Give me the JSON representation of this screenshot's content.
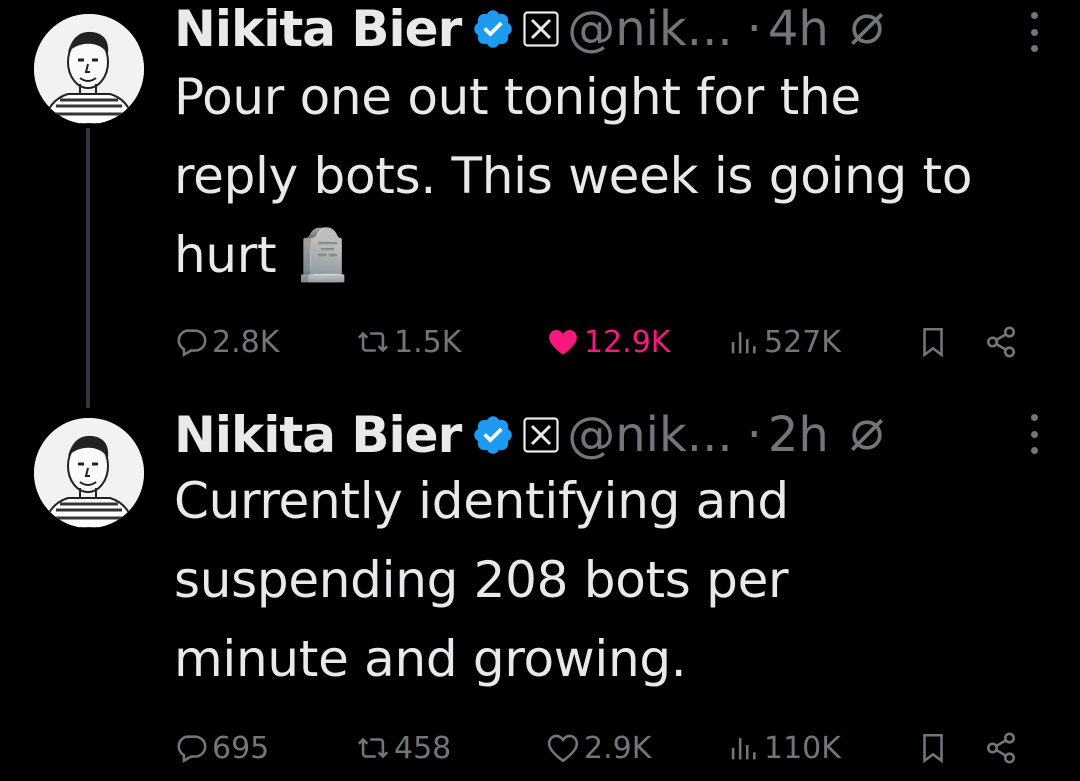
{
  "tweets": [
    {
      "author_name": "Nikita Bier",
      "handle": "@nik...",
      "separator": "·",
      "time": "4h",
      "text_lines": [
        "Pour one out tonight for the",
        "reply bots. This week is going to",
        "hurt 🪦"
      ],
      "replies": "2.8K",
      "reposts": "1.5K",
      "likes": "12.9K",
      "liked": true,
      "views": "527K"
    },
    {
      "author_name": "Nikita Bier",
      "handle": "@nik...",
      "separator": "·",
      "time": "2h",
      "text_lines": [
        "Currently identifying and",
        "suspending 208 bots per",
        "minute and growing."
      ],
      "replies": "695",
      "reposts": "458",
      "likes": "2.9K",
      "liked": false,
      "views": "110K"
    }
  ],
  "icons": {
    "verified": "verified-badge-icon",
    "affiliate": "x-affiliate-icon",
    "grok": "grok-icon",
    "more": "more-icon",
    "reply": "reply-icon",
    "repost": "repost-icon",
    "like": "heart-icon",
    "views": "views-icon",
    "bookmark": "bookmark-icon",
    "share": "share-icon"
  },
  "colors": {
    "background": "#000000",
    "text": "#e7e9ea",
    "muted": "#71767b",
    "verified": "#1d9bf0",
    "like_active": "#f91880"
  }
}
